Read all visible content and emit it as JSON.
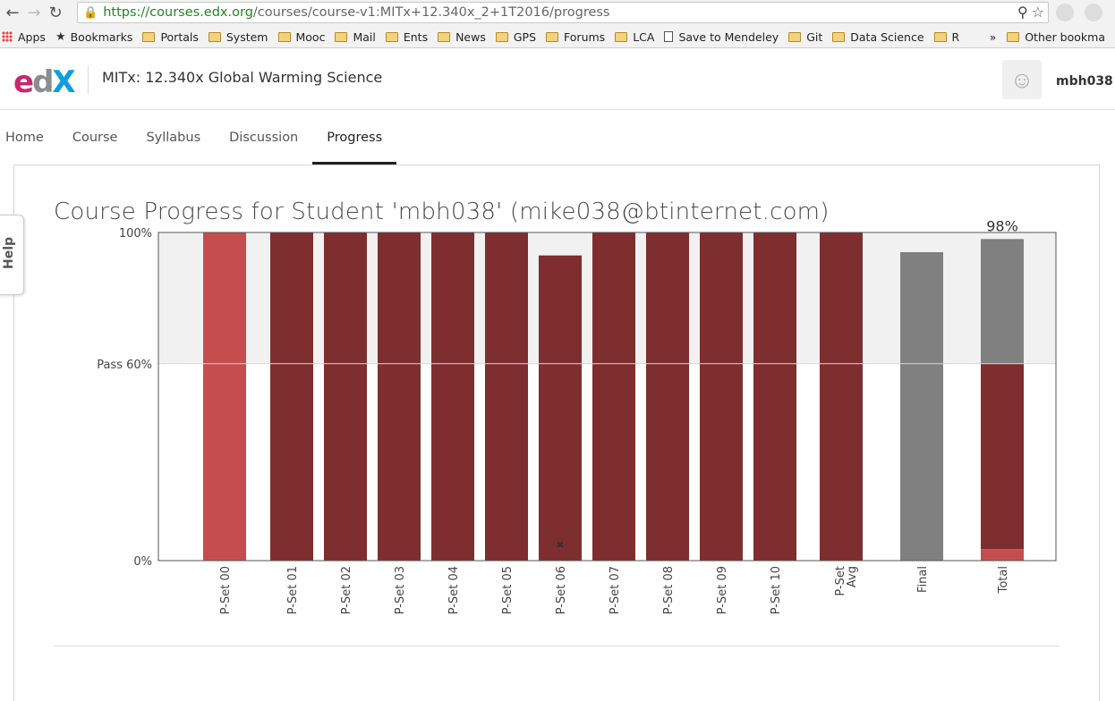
{
  "browser": {
    "url_scheme": "https://",
    "url_host": "courses.edx.org",
    "url_path": "/courses/course-v1:MITx+12.340x_2+1T2016/progress",
    "bookmarks": [
      {
        "label": "Apps",
        "icon": "apps-grid-icon"
      },
      {
        "label": "Bookmarks",
        "icon": "star-icon"
      },
      {
        "label": "Portals",
        "icon": "folder-icon"
      },
      {
        "label": "System",
        "icon": "folder-icon"
      },
      {
        "label": "Mooc",
        "icon": "folder-icon"
      },
      {
        "label": "Mail",
        "icon": "folder-icon"
      },
      {
        "label": "Ents",
        "icon": "folder-icon"
      },
      {
        "label": "News",
        "icon": "folder-icon"
      },
      {
        "label": "GPS",
        "icon": "folder-icon"
      },
      {
        "label": "Forums",
        "icon": "folder-icon"
      },
      {
        "label": "LCA",
        "icon": "folder-icon"
      },
      {
        "label": "Save to Mendeley",
        "icon": "document-icon"
      },
      {
        "label": "Git",
        "icon": "folder-icon"
      },
      {
        "label": "Data Science",
        "icon": "folder-icon"
      },
      {
        "label": "R",
        "icon": "folder-icon"
      }
    ],
    "more_chevron": "»",
    "other_bookmarks": "Other bookma"
  },
  "header": {
    "logo_e": "e",
    "logo_d": "d",
    "logo_x": "X",
    "course_title": "MITx: 12.340x Global Warming Science",
    "username": "mbh038"
  },
  "nav": {
    "tabs": [
      "Home",
      "Course",
      "Syllabus",
      "Discussion",
      "Progress"
    ],
    "active": "Progress"
  },
  "help": {
    "label": "Help"
  },
  "page": {
    "title": "Course Progress for Student 'mbh038' (mike038@btinternet.com)"
  },
  "colors": {
    "assignment": "#7e2e2f",
    "assignment_first": "#c64d4d",
    "final": "#808080",
    "pass_band": "#f1f1f1",
    "total_highlight": "#c64d4d"
  },
  "chart_data": {
    "type": "bar",
    "ylim": [
      0,
      100
    ],
    "yticks": [
      {
        "value": 0,
        "label": "0%"
      },
      {
        "value": 60,
        "label": "Pass 60%"
      },
      {
        "value": 100,
        "label": "100%"
      }
    ],
    "categories": [
      "P-Set 00",
      "P-Set 01",
      "P-Set 02",
      "P-Set 03",
      "P-Set 04",
      "P-Set 05",
      "P-Set 06",
      "P-Set 07",
      "P-Set 08",
      "P-Set 09",
      "P-Set 10",
      "P-Set Avg",
      "Final",
      "Total"
    ],
    "values": [
      100,
      100,
      100,
      100,
      100,
      100,
      93,
      100,
      100,
      100,
      100,
      100,
      94,
      98
    ],
    "bar_kinds": [
      "first",
      "assignment",
      "assignment",
      "assignment",
      "assignment",
      "assignment",
      "assignment",
      "assignment",
      "assignment",
      "assignment",
      "assignment",
      "assignment",
      "final",
      "total"
    ],
    "dropped_marker_category": "P-Set 06",
    "dropped_marker_symbol": "✖",
    "total_stack": {
      "lower_highlight": 3.5,
      "weighted_contribution": 60,
      "total": 98
    },
    "total_label": "98%"
  }
}
